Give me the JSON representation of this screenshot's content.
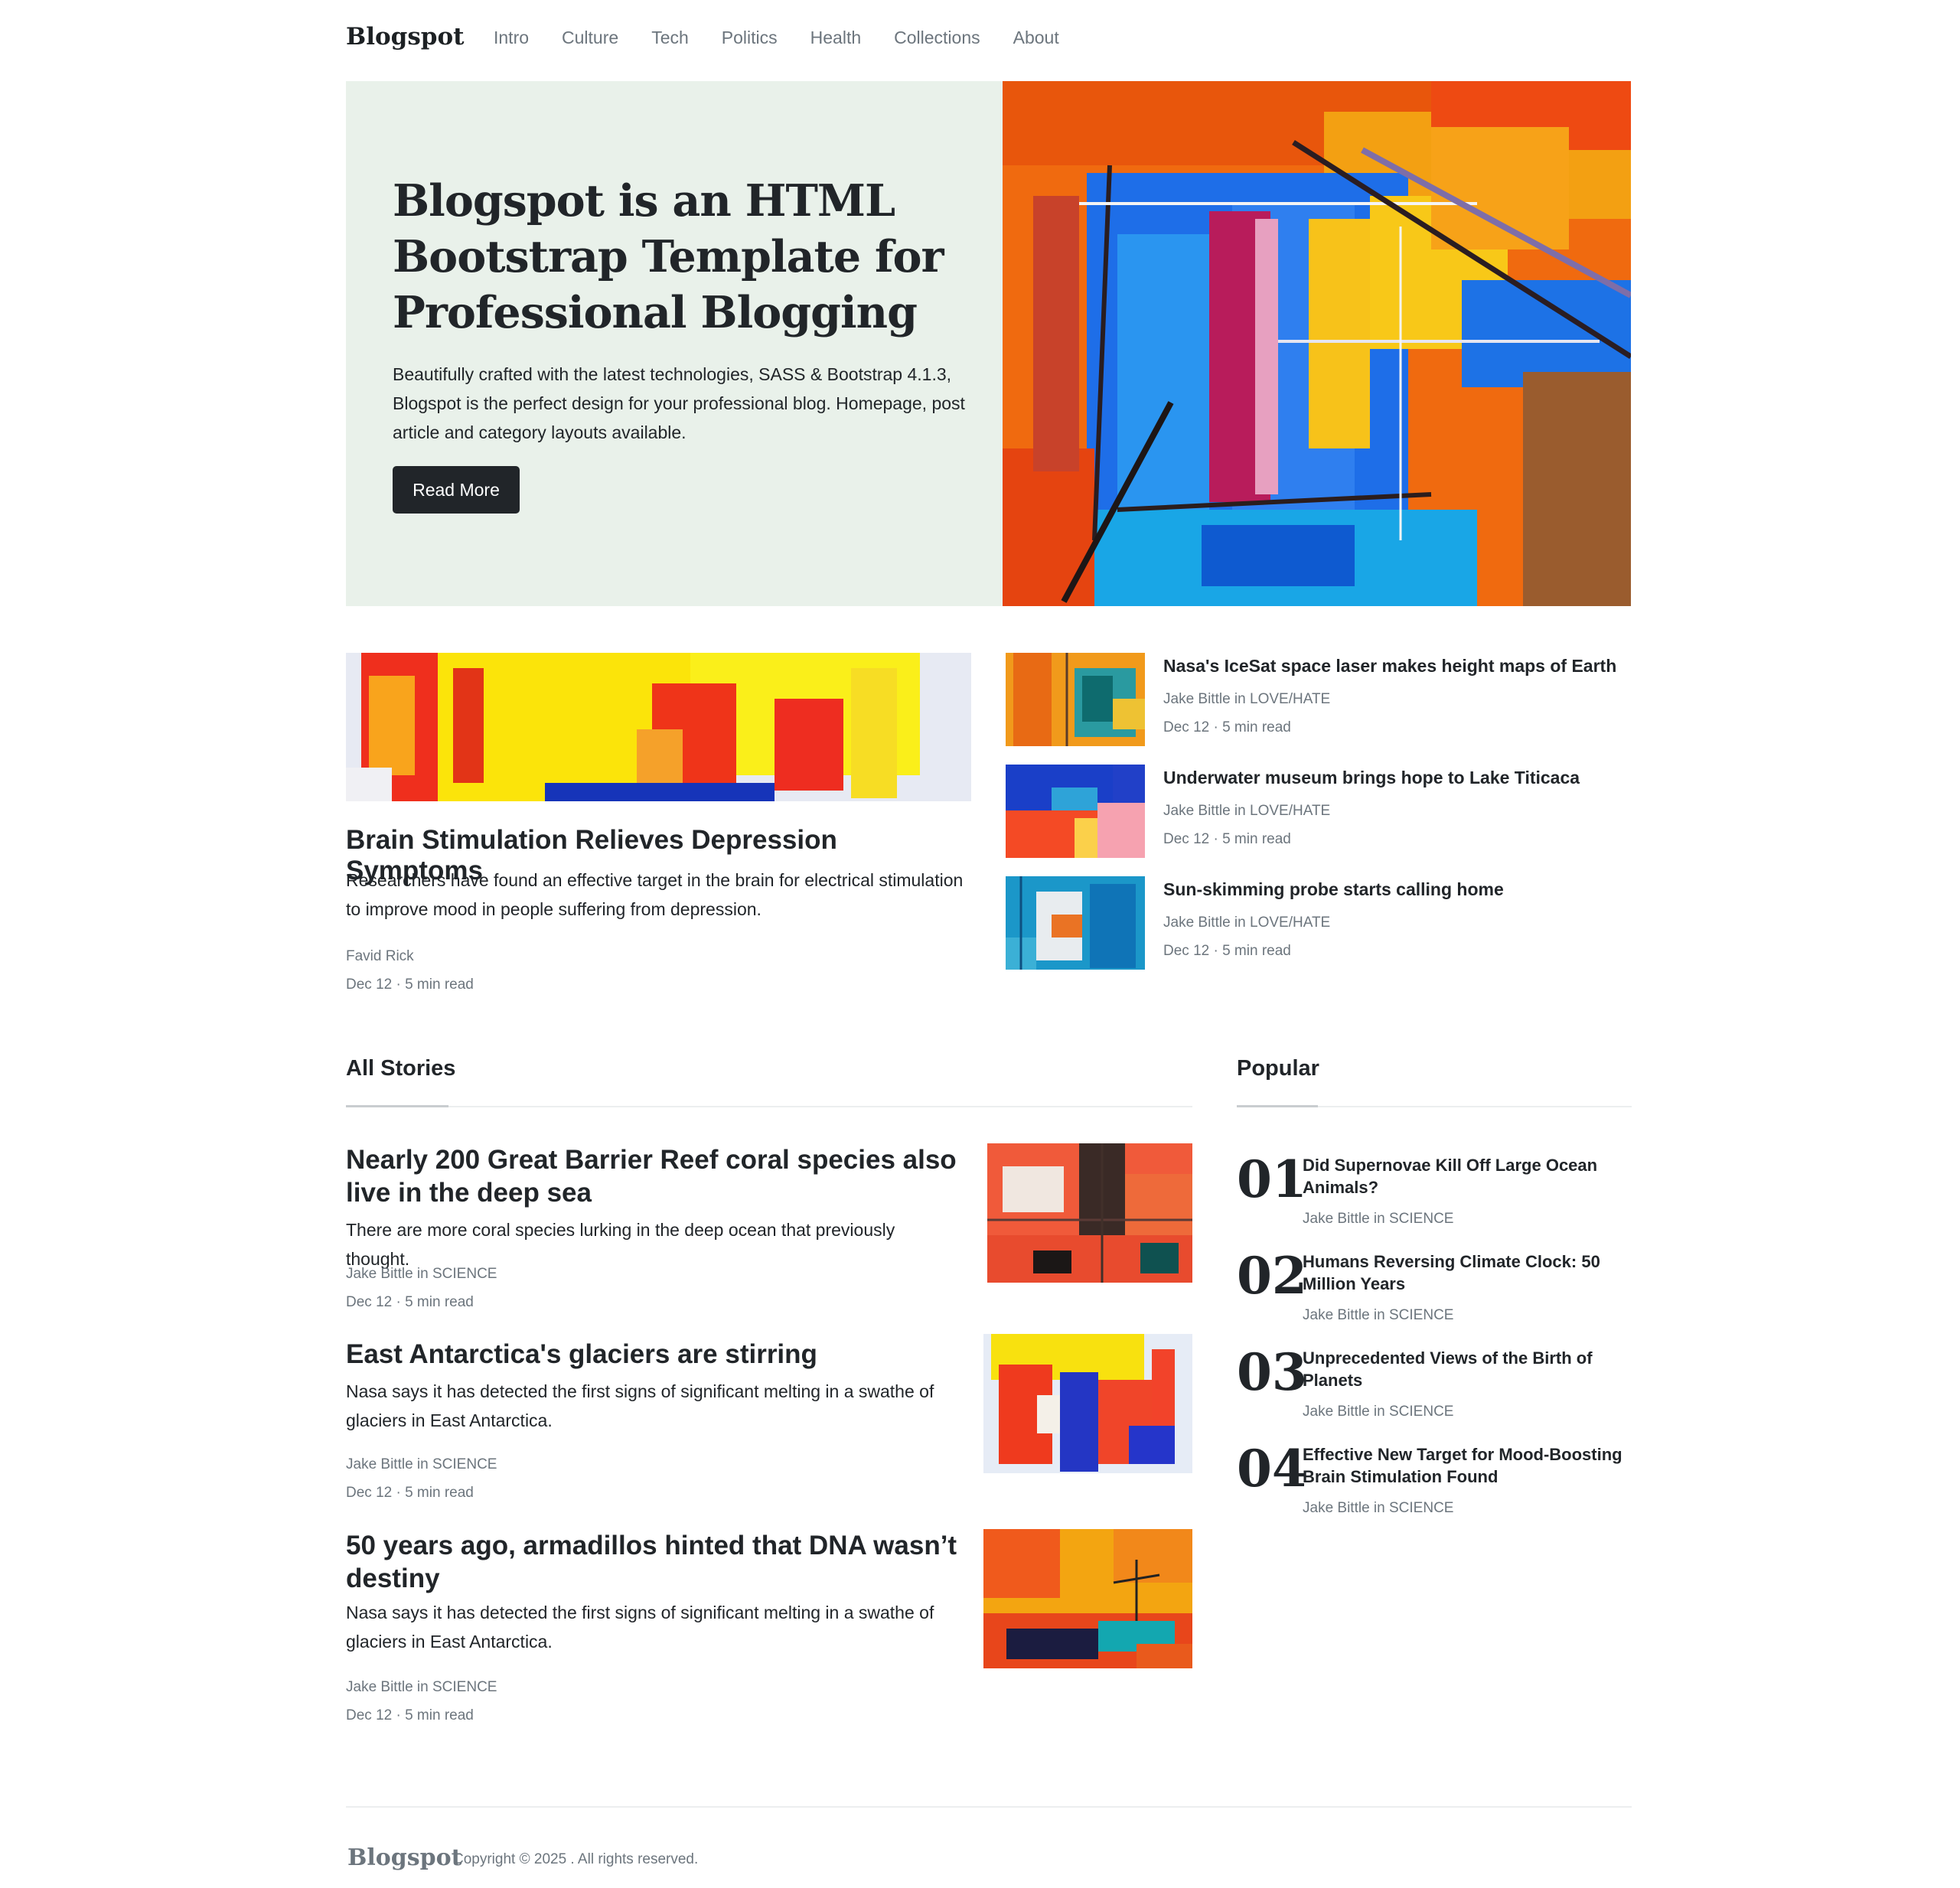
{
  "nav": {
    "brand": "Blogspot",
    "links": [
      "Intro",
      "Culture",
      "Tech",
      "Politics",
      "Health",
      "Collections",
      "About"
    ]
  },
  "hero": {
    "title": "Blogspot is an HTML Bootstrap Template for Professional Blogging",
    "description": "Beautifully crafted with the latest technologies, SASS & Bootstrap 4.1.3, Blogspot is the perfect design for your professional blog. Homepage, post article and category layouts available.",
    "button": "Read More"
  },
  "featured": {
    "title": "Brain Stimulation Relieves Depression Symptoms",
    "description": "Researchers have found an effective target in the brain for electrical stimulation to improve mood in people suffering from depression.",
    "author": "Favid Rick",
    "date": "Dec 12 · 5 min read"
  },
  "side_posts": [
    {
      "title": "Nasa's IceSat space laser makes height maps of Earth",
      "author": "Jake Bittle in LOVE/HATE",
      "date": "Dec 12 · 5 min read"
    },
    {
      "title": "Underwater museum brings hope to Lake Titicaca",
      "author": "Jake Bittle in LOVE/HATE",
      "date": "Dec 12 · 5 min read"
    },
    {
      "title": "Sun-skimming probe starts calling home",
      "author": "Jake Bittle in LOVE/HATE",
      "date": "Dec 12 · 5 min read"
    }
  ],
  "all_stories": {
    "heading": "All Stories",
    "items": [
      {
        "title": "Nearly 200 Great Barrier Reef coral species also live in the deep sea",
        "description": "There are more coral species lurking in the deep ocean that previously thought.",
        "author": "Jake Bittle in SCIENCE",
        "date": "Dec 12 · 5 min read"
      },
      {
        "title": "East Antarctica's glaciers are stirring",
        "description": "Nasa says it has detected the first signs of significant melting in a swathe of glaciers in East Antarctica.",
        "author": "Jake Bittle in SCIENCE",
        "date": "Dec 12 · 5 min read"
      },
      {
        "title": "50 years ago, armadillos hinted that DNA wasn’t destiny",
        "description": "Nasa says it has detected the first signs of significant melting in a swathe of glaciers in East Antarctica.",
        "author": "Jake Bittle in SCIENCE",
        "date": "Dec 12 · 5 min read"
      }
    ]
  },
  "popular": {
    "heading": "Popular",
    "items": [
      {
        "num": "01",
        "title": "Did Supernovae Kill Off Large Ocean Animals?",
        "author": "Jake Bittle in SCIENCE"
      },
      {
        "num": "02",
        "title": "Humans Reversing Climate Clock: 50 Million Years",
        "author": "Jake Bittle in SCIENCE"
      },
      {
        "num": "03",
        "title": "Unprecedented Views of the Birth of Planets",
        "author": "Jake Bittle in SCIENCE"
      },
      {
        "num": "04",
        "title": "Effective New Target for Mood-Boosting Brain Stimulation Found",
        "author": "Jake Bittle in SCIENCE"
      }
    ]
  },
  "footer": {
    "brand": "Blogspot",
    "copyright": "Copyright © 2025 . All rights reserved."
  },
  "colors": {
    "hero_bg": "#e9f1ea",
    "text_dark": "#212529",
    "text_muted": "#6c757d",
    "button_bg": "#212529"
  }
}
